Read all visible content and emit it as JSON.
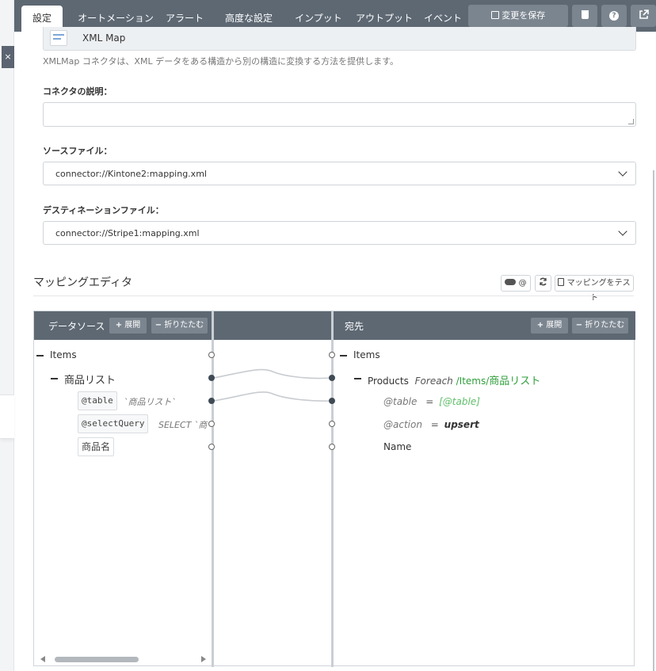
{
  "tabs": [
    {
      "label": "設定"
    },
    {
      "label": "オートメーション"
    },
    {
      "label": "アラート"
    },
    {
      "label": "高度な設定"
    },
    {
      "label": "インプット"
    },
    {
      "label": "アウトプット"
    },
    {
      "label": "イベント"
    }
  ],
  "toolbar": {
    "save_label": "変更を保存",
    "help_glyph": "?",
    "delete_icon": "trash-icon",
    "external_icon": "external-link-icon"
  },
  "close_glyph": "×",
  "connector": {
    "name": "XML Map",
    "hint": "XMLMap コネクタは、XML データをある構造から別の構造に変換する方法を提供します。"
  },
  "form": {
    "description_label": "コネクタの説明：",
    "description_value": "",
    "source_label": "ソースファイル：",
    "source_value": "connector://Kintone2:mapping.xml",
    "dest_label": "デスティネーションファイル：",
    "dest_value": "connector://Stripe1:mapping.xml"
  },
  "mapping_editor": {
    "title": "マッピングエディタ",
    "toggle_label": "@",
    "test_label": "マッピングをテスト",
    "source": {
      "title": "データソース",
      "expand": "展開",
      "collapse": "折りたたむ",
      "root": "Items",
      "list": "商品リスト",
      "attr_table": "@table",
      "attr_table_value": "`商品リスト`",
      "attr_query": "@selectQuery",
      "attr_query_value": "SELECT `商",
      "field": "商品名"
    },
    "dest": {
      "title": "宛先",
      "expand": "展開",
      "collapse": "折りたたむ",
      "root": "Items",
      "products": "Products",
      "foreach": "Foreach",
      "path_sep1": "/",
      "path_items": "Items",
      "path_sep2": "/",
      "path_list": "商品リスト",
      "attr_table": "@table",
      "eq1": "=",
      "attr_table_value": "[@table]",
      "attr_action": "@action",
      "eq2": "=",
      "attr_action_value": "upsert",
      "field": "Name"
    }
  },
  "colors": {
    "topbar": "#5d6873",
    "accent_green": "#2e9e3a",
    "node_filled": "#3f4a55"
  }
}
